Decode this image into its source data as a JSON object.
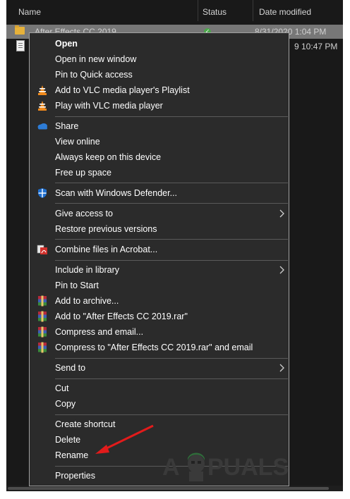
{
  "header": {
    "name": "Name",
    "status": "Status",
    "date_modified": "Date modified"
  },
  "files": [
    {
      "name": "After Effects CC 2019",
      "date": "8/31/2020 1:04 PM"
    },
    {
      "name": "",
      "date": "9 10:47 PM"
    }
  ],
  "menu": {
    "open": "Open",
    "open_new_window": "Open in new window",
    "pin_quick_access": "Pin to Quick access",
    "vlc_playlist": "Add to VLC media player's Playlist",
    "vlc_play": "Play with VLC media player",
    "share": "Share",
    "view_online": "View online",
    "always_keep": "Always keep on this device",
    "free_up": "Free up space",
    "defender": "Scan with Windows Defender...",
    "give_access": "Give access to",
    "restore": "Restore previous versions",
    "acrobat": "Combine files in Acrobat...",
    "include_library": "Include in library",
    "pin_start": "Pin to Start",
    "add_archive": "Add to archive...",
    "add_rar": "Add to \"After Effects CC 2019.rar\"",
    "compress_email": "Compress and email...",
    "compress_rar_email": "Compress to \"After Effects CC 2019.rar\" and email",
    "send_to": "Send to",
    "cut": "Cut",
    "copy": "Copy",
    "create_shortcut": "Create shortcut",
    "delete": "Delete",
    "rename": "Rename",
    "properties": "Properties"
  },
  "watermark": {
    "text_a": "A",
    "text_rest": "PUALS"
  },
  "colors": {
    "menu_bg": "#2b2b2b",
    "explorer_bg": "#191919",
    "selected_row": "#777777",
    "arrow": "#e21b1b",
    "vlc_orange": "#f08a1c",
    "onedrive_blue": "#2d7cd6",
    "defender_blue": "#1e6fd0",
    "winrar_red": "#b52a3a"
  },
  "icons": [
    "folder-icon",
    "file-icon",
    "sync-status-icon",
    "vlc-icon",
    "onedrive-cloud-icon",
    "windows-defender-icon",
    "acrobat-icon",
    "winrar-icon",
    "chevron-right-icon"
  ]
}
